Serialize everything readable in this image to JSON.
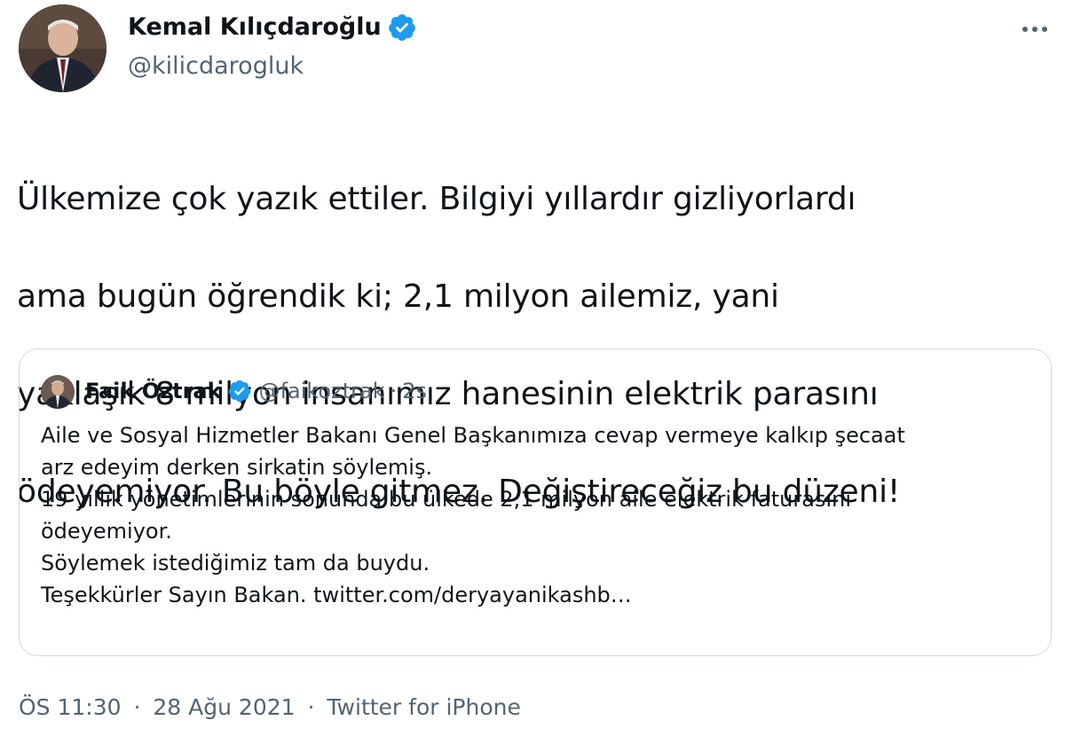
{
  "author": {
    "name": "Kemal Kılıçdaroğlu",
    "handle": "@kilicdarogluk",
    "avatar_icon": "portrait-photo",
    "verified_icon": "verified-badge-icon"
  },
  "more_icon": "more-horizontal-icon",
  "tweet": {
    "lines": [
      "Ülkemize çok yazık ettiler. Bilgiyi yıllardır gizliyorlardı",
      "ama bugün öğrendik ki; 2,1 milyon ailemiz, yani",
      "yaklaşık 8 milyon insanımız hanesinin elektrik parasını",
      "ödeyemiyor. Bu böyle gitmez. Değiştireceğiz bu düzeni!"
    ]
  },
  "quote": {
    "name": "Faik Öztrak",
    "handle": "@faikoztrak",
    "separator": "·",
    "time": "2s",
    "lines": [
      "Aile ve Sosyal Hizmetler Bakanı Genel Başkanımıza cevap vermeye kalkıp şecaat",
      "arz edeyim derken sirkatin söylemiş.",
      "19 yıllık yönetimlerinin sonunda bu ülkede 2,1 milyon aile elektrik faturasını",
      "ödeyemiyor.",
      "Söylemek istediğimiz tam da buydu.",
      "Teşekkürler Sayın Bakan. twitter.com/deryayanikashb…"
    ]
  },
  "footer": {
    "time": "ÖS 11:30",
    "date": "28 Ağu 2021",
    "source": "Twitter for iPhone",
    "separator": "·"
  },
  "colors": {
    "verified": "#1d9bf0",
    "secondary_text": "#536471",
    "border": "#cfd9de"
  }
}
